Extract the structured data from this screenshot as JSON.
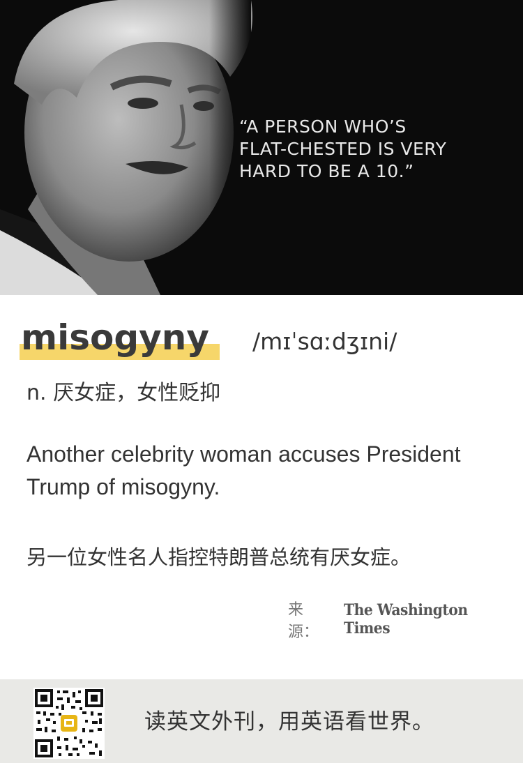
{
  "hero": {
    "quote": "“A PERSON WHO’S\nFLAT-CHESTED IS VERY\nHARD TO BE A 10.”"
  },
  "entry": {
    "word": "misogyny",
    "phonetic": "/mɪˈsɑːdʒɪni/",
    "definition": "n. 厌女症，女性贬抑",
    "example_en": "Another celebrity woman accuses President Trump of misogyny.",
    "example_zh": "另一位女性名人指控特朗普总统有厌女症。"
  },
  "source": {
    "label": "来源：",
    "publication": "The Washington Times"
  },
  "footer": {
    "slogan": "读英文外刊，用英语看世界。"
  },
  "colors": {
    "highlight": "#f6d66a",
    "footer_bg": "#e9e9e6",
    "hero_bg": "#0b0b0b"
  }
}
